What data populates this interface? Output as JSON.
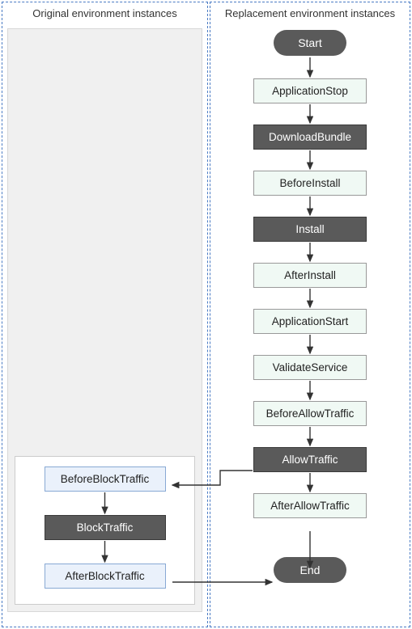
{
  "diagram": {
    "left_col_title": "Original environment instances",
    "right_col_title": "Replacement environment instances",
    "start_label": "Start",
    "end_label": "End",
    "right_flow": {
      "n0": "ApplicationStop",
      "n1": "DownloadBundle",
      "n2": "BeforeInstall",
      "n3": "Install",
      "n4": "AfterInstall",
      "n5": "ApplicationStart",
      "n6": "ValidateService",
      "n7": "BeforeAllowTraffic",
      "n8": "AllowTraffic",
      "n9": "AfterAllowTraffic"
    },
    "left_flow": {
      "b0": "BeforeBlockTraffic",
      "b1": "BlockTraffic",
      "b2": "AfterBlockTraffic"
    }
  },
  "chart_data": {
    "type": "flowchart",
    "lanes": [
      {
        "name": "Original environment instances",
        "id": "orig"
      },
      {
        "name": "Replacement environment instances",
        "id": "repl"
      }
    ],
    "nodes": [
      {
        "id": "start",
        "lane": "repl",
        "label": "Start",
        "kind": "terminal"
      },
      {
        "id": "appstop",
        "lane": "repl",
        "label": "ApplicationStop",
        "kind": "hook"
      },
      {
        "id": "download",
        "lane": "repl",
        "label": "DownloadBundle",
        "kind": "system"
      },
      {
        "id": "beforeinstall",
        "lane": "repl",
        "label": "BeforeInstall",
        "kind": "hook"
      },
      {
        "id": "install",
        "lane": "repl",
        "label": "Install",
        "kind": "system"
      },
      {
        "id": "afterinstall",
        "lane": "repl",
        "label": "AfterInstall",
        "kind": "hook"
      },
      {
        "id": "appstart",
        "lane": "repl",
        "label": "ApplicationStart",
        "kind": "hook"
      },
      {
        "id": "validate",
        "lane": "repl",
        "label": "ValidateService",
        "kind": "hook"
      },
      {
        "id": "beforeallow",
        "lane": "repl",
        "label": "BeforeAllowTraffic",
        "kind": "hook"
      },
      {
        "id": "allow",
        "lane": "repl",
        "label": "AllowTraffic",
        "kind": "system"
      },
      {
        "id": "afterallow",
        "lane": "repl",
        "label": "AfterAllowTraffic",
        "kind": "hook"
      },
      {
        "id": "beforeblock",
        "lane": "orig",
        "label": "BeforeBlockTraffic",
        "kind": "hook"
      },
      {
        "id": "block",
        "lane": "orig",
        "label": "BlockTraffic",
        "kind": "system"
      },
      {
        "id": "afterblock",
        "lane": "orig",
        "label": "AfterBlockTraffic",
        "kind": "hook"
      },
      {
        "id": "end",
        "lane": "repl",
        "label": "End",
        "kind": "terminal"
      }
    ],
    "edges": [
      [
        "start",
        "appstop"
      ],
      [
        "appstop",
        "download"
      ],
      [
        "download",
        "beforeinstall"
      ],
      [
        "beforeinstall",
        "install"
      ],
      [
        "install",
        "afterinstall"
      ],
      [
        "afterinstall",
        "appstart"
      ],
      [
        "appstart",
        "validate"
      ],
      [
        "validate",
        "beforeallow"
      ],
      [
        "beforeallow",
        "allow"
      ],
      [
        "allow",
        "afterallow"
      ],
      [
        "allow",
        "beforeblock"
      ],
      [
        "beforeblock",
        "block"
      ],
      [
        "block",
        "afterblock"
      ],
      [
        "afterallow",
        "end"
      ],
      [
        "afterblock",
        "end"
      ]
    ]
  }
}
